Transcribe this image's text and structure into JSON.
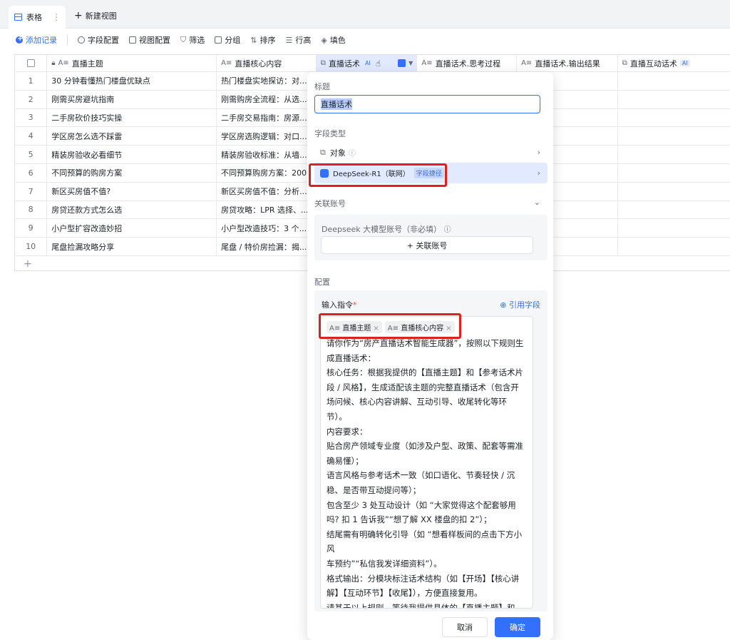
{
  "tabs": {
    "active": "表格",
    "new_view": "新建视图"
  },
  "toolbar": {
    "add_record": "添加记录",
    "field_config": "字段配置",
    "view_config": "视图配置",
    "filter": "筛选",
    "group": "分组",
    "sort": "排序",
    "row_height": "行高",
    "fill": "填色"
  },
  "columns": {
    "topic": "直播主题",
    "core": "直播核心内容",
    "script": "直播话术",
    "think": "直播话术.思考过程",
    "output": "直播话术.输出结果",
    "interact": "直播互动话术",
    "ai_tag": "AI"
  },
  "rows": [
    {
      "num": "1",
      "topic": "30 分钟看懂热门楼盘优缺点",
      "core": "热门楼盘实地探访：对..."
    },
    {
      "num": "2",
      "topic": "刚需买房避坑指南",
      "core": "刚需购房全流程：从选..."
    },
    {
      "num": "3",
      "topic": "二手房砍价技巧实操",
      "core": "二手房交易指南：房源..."
    },
    {
      "num": "4",
      "topic": "学区房怎么选不踩雷",
      "core": "学区房选购逻辑：对口..."
    },
    {
      "num": "5",
      "topic": "精装房验收必看细节",
      "core": "精装房验收标准：从墙..."
    },
    {
      "num": "6",
      "topic": "不同预算的购房方案",
      "core": "不同预算购房方案：200..."
    },
    {
      "num": "7",
      "topic": "新区买房值不值?",
      "core": "新区买房值不值：分析..."
    },
    {
      "num": "8",
      "topic": "房贷还款方式怎么选",
      "core": "房贷攻略：LPR 选择、..."
    },
    {
      "num": "9",
      "topic": "小户型扩容改造妙招",
      "core": "小户型改造技巧：3 个..."
    },
    {
      "num": "10",
      "topic": "尾盘捡漏攻略分享",
      "core": "尾盘 / 特价房捡漏：揭..."
    }
  ],
  "panel": {
    "title_label": "标题",
    "title_value": "直播话术",
    "field_type_label": "字段类型",
    "type_object": "对象",
    "type_model": "DeepSeek-R1（联网）",
    "type_model_tag": "字段捷径",
    "account_label": "关联账号",
    "account_field": "Deepseek 大模型账号（非必填）",
    "account_btn": "+ 关联账号",
    "config_label": "配置",
    "instruction_label": "输入指令",
    "required_mark": "*",
    "ref_field": "引用字段",
    "chip1": "直播主题",
    "chip2": "直播核心内容",
    "prompt": "请你作为“房产直播话术智能生成器”，按照以下规则生\n成直播话术：\n核心任务：根据我提供的【直播主题】和【参考话术片\n段 / 风格】，生成适配该主题的完整直播话术（包含开\n场问候、核心内容讲解、互动引导、收尾转化等环\n节）。\n内容要求：\n贴合房产领域专业度（如涉及户型、政策、配套等需准\n确易懂）；\n语言风格与参考话术一致（如口语化、节奏轻快 / 沉\n稳、是否带互动提问等）；\n包含至少 3 处互动设计（如 “大家觉得这个配套够用\n吗? 扣 1 告诉我”“想了解 XX 楼盘的扣 2”）；\n结尾需有明确转化引导（如 “想看样板间的点击下方小风\n车预约”“私信我发详细资料”）。\n格式输出：分模块标注话术结构（如【开场】【核心讲\n解】【互动环节】【收尾】），方便直接复用。\n请基于以上规则，等待我提供具体的【直播主题】和\n【参考话术】后，生成对应的直播话术。",
    "cancel": "取消",
    "confirm": "确定"
  },
  "colors": {
    "accent": "#3370ff",
    "highlight": "#e0201e"
  }
}
